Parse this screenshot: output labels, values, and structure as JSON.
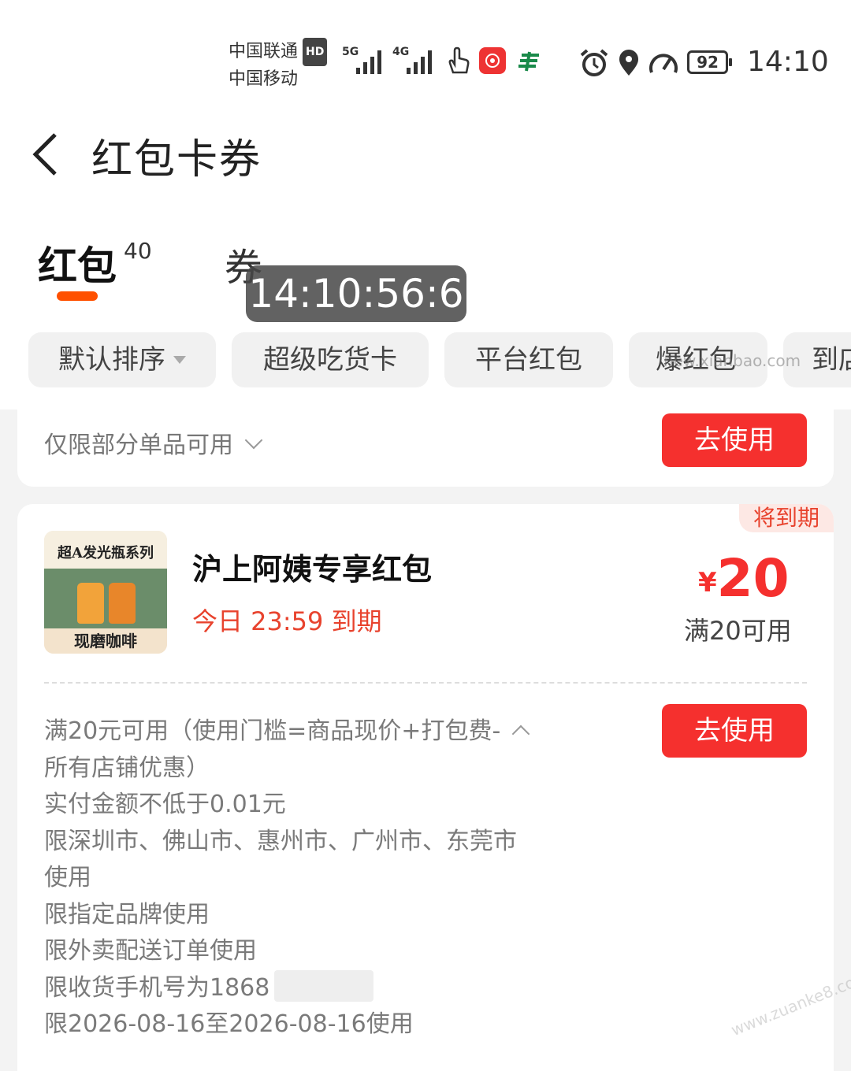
{
  "status_bar": {
    "carrier1": "中国联通",
    "hd": "HD",
    "carrier2": "中国移动",
    "sig1": "5G",
    "sig2": "4G",
    "battery": "92",
    "time": "14:10"
  },
  "header": {
    "title": "红包卡券"
  },
  "tabs": {
    "hongbao": "红包",
    "hongbao_count": "40",
    "quan": "券"
  },
  "overlay_time": "14:10:56:6",
  "filters": [
    "默认排序",
    "超级吃货卡",
    "平台红包",
    "爆红包",
    "到店"
  ],
  "card1": {
    "note": "仅限部分单品可用",
    "button": "去使用"
  },
  "card2": {
    "badge": "将到期",
    "thumb_top": "超A发光瓶系列",
    "thumb_bottom": "现磨咖啡",
    "name": "沪上阿姨专享红包",
    "expire": "今日 23:59 到期",
    "currency": "¥",
    "amount": "20",
    "condition": "满20可用",
    "button": "去使用",
    "rules": [
      "满20元可用（使用门槛=商品现价+打包费-",
      "所有店铺优惠）",
      "实付金额不低于0.01元",
      "限深圳市、佛山市、惠州市、广州市、东莞市",
      "使用",
      "限指定品牌使用",
      "限外卖配送订单使用",
      "限收货手机号为1868",
      "限2026-08-16至2026-08-16使用"
    ]
  },
  "watermarks": {
    "wm1": "new.xianbao.com",
    "wm2": "www.zuanke8.com"
  },
  "colors": {
    "accent": "#f5302e",
    "tab_indicator": "#ff5000",
    "expiring_text": "#e8432e"
  }
}
